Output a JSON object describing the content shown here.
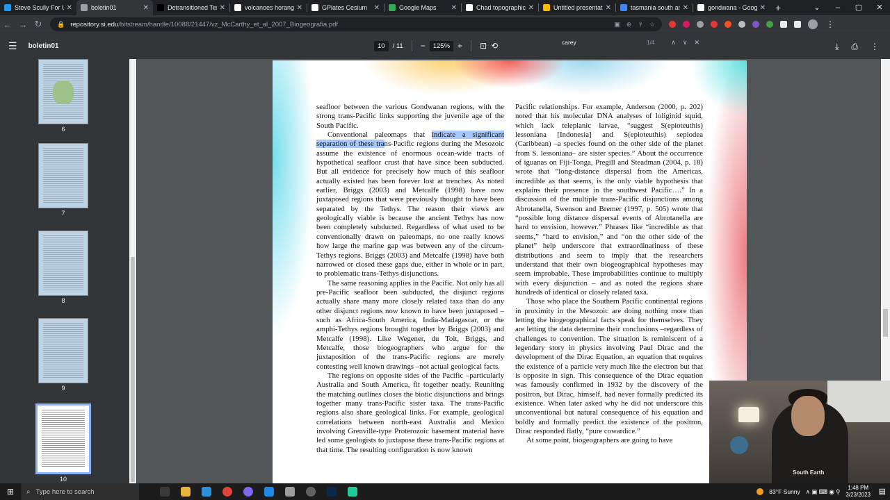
{
  "tabs": [
    {
      "title": "Steve Scully For US",
      "favicon_color": "#1d9bf0",
      "active": false
    },
    {
      "title": "boletin01",
      "favicon_color": "#9aa0a6",
      "active": true
    },
    {
      "title": "Detransitioned Ter",
      "favicon_color": "#000000",
      "active": false
    },
    {
      "title": "volcanoes horang",
      "favicon_color": "#ffffff",
      "active": false
    },
    {
      "title": "GPlates Cesium",
      "favicon_color": "#ffffff",
      "active": false
    },
    {
      "title": "Google Maps",
      "favicon_color": "#34a853",
      "active": false
    },
    {
      "title": "Chad topographic",
      "favicon_color": "#ffffff",
      "active": false
    },
    {
      "title": "Untitled presentat",
      "favicon_color": "#fbbc04",
      "active": false
    },
    {
      "title": "tasmania south an",
      "favicon_color": "#4285f4",
      "active": false
    },
    {
      "title": "gondwana - Goog",
      "favicon_color": "#ffffff",
      "active": false
    }
  ],
  "address": {
    "host": "repository.si.edu",
    "path": "/bitstream/handle/10088/21447/vz_McCarthy_et_al_2007_Biogeografia.pdf"
  },
  "pdf": {
    "doc_name": "boletin01",
    "current_page": "10",
    "total_pages": "/ 11",
    "zoom": "125%"
  },
  "find": {
    "query": "carey",
    "count": "1/4"
  },
  "thumbnails": [
    {
      "label": "6",
      "selected": false
    },
    {
      "label": "7",
      "selected": false
    },
    {
      "label": "8",
      "selected": false
    },
    {
      "label": "9",
      "selected": false
    },
    {
      "label": "10",
      "selected": true
    }
  ],
  "left_column": [
    "seafloor between the various Gondwanan regions, with the strong trans-Pacific links supporting the juvenile age of the South Pacific.",
    "Conventional paleomaps that ",
    "indicate a significant separation of these tra",
    "ns-Pacific regions during the Mesozoic assume the existence of enormous ocean-wide tracts of hypothetical seafloor crust that have since been subducted. But all evidence for precisely how much of this seafloor actually existed has been forever lost at trenches. As noted earlier, Briggs (2003) and Metcalfe (1998) have now juxtaposed regions that were previously thought to have been separated by the Tethys. The reason their views are geologically viable is because the ancient Tethys has now been completely subducted. Regardless of what used to be conventionally drawn on paleomaps, no one really knows how large the marine gap was between any of the circum-Tethys regions. Briggs (2003) and Metcalfe (1998) have both narrowed or closed these gaps due, either in whole or in part, to problematic trans-Tethys disjunctions.",
    "The same reasoning applies in the Pacific. Not only has all pre-Pacific seafloor been subducted, the disjunct regions actually share many more closely related taxa than do any other disjunct regions now known to have been juxtaposed –such as Africa-South America, India-Madagascar, or the amphi-Tethys regions brought together by Briggs (2003) and Metcalfe (1998). Like Wegener, du Toit, Briggs, and Metcalfe, those biogeographers who argue for the juxtaposition of the trans-Pacific regions are merely contesting well known drawings –not actual geological facts.",
    "The regions on opposite sides of the Pacific –particularly Australia and South America, fit together neatly. Reuniting the matching outlines closes the biotic disjunctions and brings together many trans-Pacific sister taxa. The trans-Pacific regions also share geological links. For example, geological correlations between north-east Australia and Mexico involving Grenville-type Proterozoic basement material have led some geologists to juxtapose these trans-Pacific regions at that time. The resulting configuration is now known"
  ],
  "right_column": [
    "Pacific relationships. For example, Anderson (2000, p. 202) noted that his molecular DNA analyses of loliginid squid, which lack teleplanic larvae, “suggest S(epioteuthis) lessoniana [Indonesia] and S(epioteuthis) sepiodea (Caribbean) –a species found on the other side of the planet from S. lessoniana– are sister species.” About the occurrence of iguanas on Fiji-Tonga, Pregill and Steadman (2004, p. 18) wrote that “long-distance dispersal from the Americas, incredible as that seems, is the only viable hypothesis that explains their presence in the southwest Pacific….” In a discussion of the multiple trans-Pacific disjunctions among Abrotanella, Swenson and Bremer (1997, p. 505) wrote that “possible long distance dispersal events of Abrotanella are hard to envision, however.” Phrases like “incredible as that seems,” “hard to envision,” and “on the other side of the planet” help underscore that extraordinariness of these distributions and seem to imply that the researchers understand that their own biogeographical hypotheses may seem improbable. These improbabilities continue to multiply with every disjunction – and as noted the regions share hundreds of identical or closely related taxa.",
    "Those who place the Southern Pacific continental regions in proximity in the Mesozoic are doing nothing more than letting the biogeographical facts speak for themselves. They are letting the data determine their conclusions –regardless of challenges to convention. The situation is reminiscent of a legendary story in physics involving Paul Dirac and the development of the Dirac Equation, an equation that requires the existence of a particle very much like the electron but that is opposite in sign. This consequence of the Dirac equation was famously confirmed in 1932 by the discovery of the positron, but Dirac, himself, had never formally predicted its existence. When later asked why he did not underscore this unconventional but natural consequence of his equation and boldly and formally predict the existence of the positron, Dirac responded flatly, “pure cowardice.”",
    "At some point, biogeographers are going to have"
  ],
  "webcam": {
    "shirt_text": "South Earth"
  },
  "taskbar": {
    "search_placeholder": "Type here to search",
    "weather": "83°F  Sunny",
    "time": "1:48 PM",
    "date": "3/23/2023"
  }
}
